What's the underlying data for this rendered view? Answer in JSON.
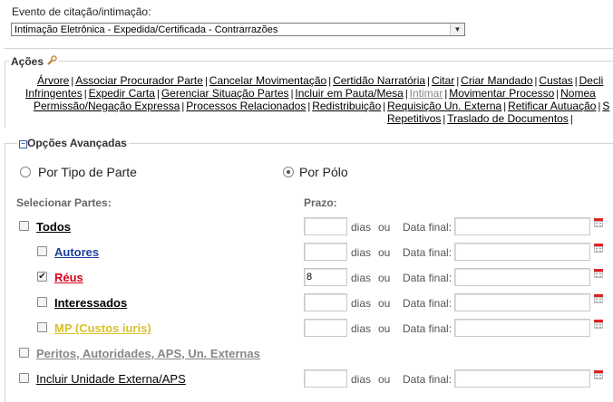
{
  "evento": {
    "label": "Evento de citação/intimação:",
    "selected": "Intimação Eletrônica - Expedida/Certificada - Contrarrazões"
  },
  "acoes": {
    "legend": "Ações",
    "lines": [
      [
        "Árvore",
        "Associar Procurador Parte",
        "Cancelar Movimentação",
        "Certidão Narratória",
        "Citar",
        "Criar Mandado",
        "Custas",
        "Decli"
      ],
      [
        "Infringentes",
        "Expedir Carta",
        "Gerenciar Situação Partes",
        "Incluir em Pauta/Mesa",
        "Intimar",
        "Movimentar Processo",
        "Nomea"
      ],
      [
        "Permissão/Negação Expressa",
        "Processos Relacionados",
        "Redistribuição",
        "Requisição Un. Externa",
        "Retificar Autuação",
        "S"
      ],
      [
        "Repetitivos",
        "Traslado de Documentos"
      ]
    ],
    "disabled": [
      "Intimar"
    ]
  },
  "opcoes": {
    "legend": "Opções Avançadas",
    "collapse_icon": "minus-box-icon",
    "radio_tipo": "Por Tipo de Parte",
    "radio_polo": "Por Pólo",
    "selected_radio": "Por Pólo",
    "hdr_partes": "Selecionar Partes:",
    "hdr_prazo": "Prazo:",
    "dias": "dias",
    "ou": "ou",
    "data_final": "Data final:",
    "rows": [
      {
        "label": "Todos",
        "checked": false,
        "prazo": "",
        "color": "#000000",
        "indent": false
      },
      {
        "label": "Autores",
        "checked": false,
        "prazo": "",
        "color": "#1f3f9e",
        "indent": true
      },
      {
        "label": "Réus",
        "checked": true,
        "prazo": "8",
        "color": "#d8001c",
        "indent": true
      },
      {
        "label": "Interessados",
        "checked": false,
        "prazo": "",
        "color": "#000000",
        "indent": true
      },
      {
        "label": "MP (Custos iuris)",
        "checked": false,
        "prazo": "",
        "color": "#d8c02a",
        "indent": true
      },
      {
        "label": "Peritos, Autoridades, APS, Un. Externas",
        "checked": false,
        "prazo": null,
        "color": "#888888",
        "indent": false,
        "bold": true
      },
      {
        "label": "Incluir Unidade Externa/APS",
        "checked": false,
        "prazo": "",
        "color": "#000000",
        "indent": false,
        "bold": false
      }
    ]
  }
}
